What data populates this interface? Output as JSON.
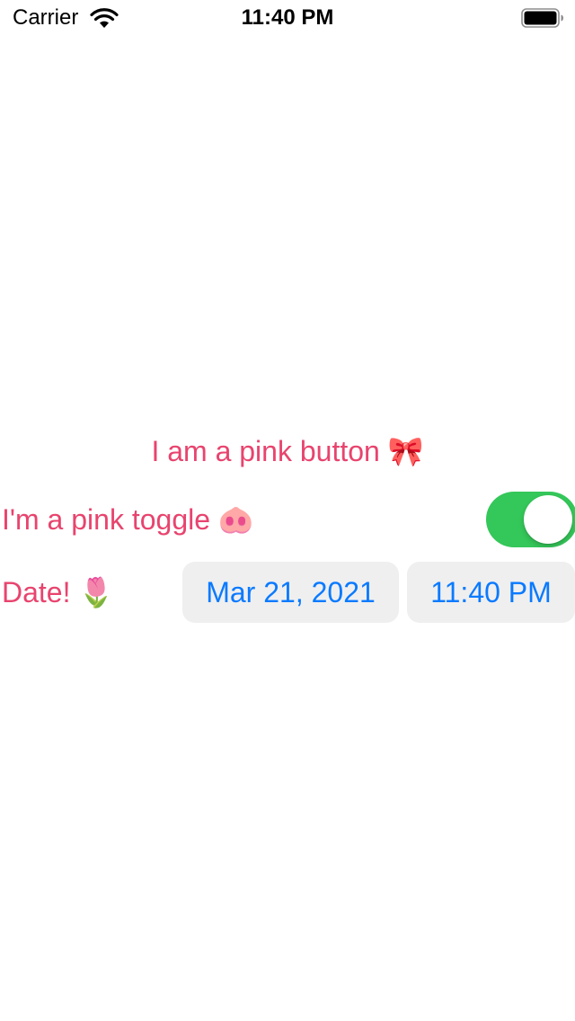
{
  "status_bar": {
    "carrier": "Carrier",
    "time": "11:40 PM",
    "icons": [
      "wifi-icon",
      "battery-icon"
    ]
  },
  "button": {
    "label": "I am a pink button 🎀"
  },
  "toggle": {
    "label": "I'm a pink toggle 🐽",
    "is_on": true
  },
  "date_picker": {
    "label": "Date! 🌷",
    "date": "Mar 21, 2021",
    "time": "11:40 PM"
  },
  "colors": {
    "accent_pink": "#e8446e",
    "toggle_on": "#34c759",
    "picker_text": "#0a7aff",
    "picker_bg": "#efeff0"
  }
}
